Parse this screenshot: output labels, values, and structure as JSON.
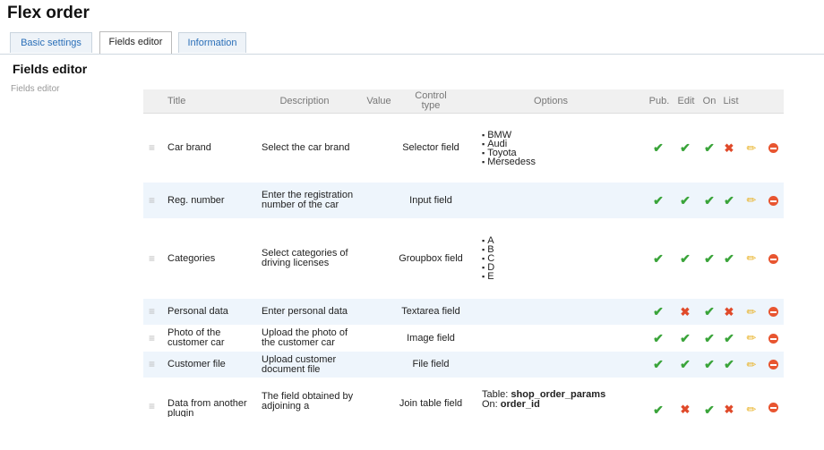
{
  "page": {
    "title": "Flex order"
  },
  "tabs": [
    {
      "label": "Basic settings"
    },
    {
      "label": "Fields editor"
    },
    {
      "label": "Information"
    }
  ],
  "section": {
    "title": "Fields editor",
    "side_label": "Fields editor"
  },
  "columns": {
    "title": "Title",
    "description": "Description",
    "value": "Value",
    "control_type": "Control type",
    "options": "Options",
    "pub": "Pub.",
    "edit": "Edit",
    "on": "On",
    "list": "List"
  },
  "icons": {
    "handle": "drag-handle-icon",
    "check": "check-icon",
    "cross": "cross-icon",
    "edit": "pencil-icon",
    "delete": "delete-icon"
  },
  "colors": {
    "tab_link": "#2a6fb8",
    "check": "#3aa43a",
    "cross": "#e04a2a",
    "pencil": "#e8b020",
    "delete": "#e85530",
    "row_alt": "#eef5fc"
  },
  "rows": [
    {
      "title": "Car brand",
      "description": "Select the car brand",
      "control_type": "Selector field",
      "options": [
        "BMW",
        "Audi",
        "Toyota",
        "Mersedess"
      ],
      "pub": true,
      "edit": true,
      "on": true,
      "list": false
    },
    {
      "title": "Reg. number",
      "description": "Enter the registration number of the car",
      "control_type": "Input field",
      "options": [],
      "pub": true,
      "edit": true,
      "on": true,
      "list": true
    },
    {
      "title": "Categories",
      "description": "Select categories of driving licenses",
      "control_type": "Groupbox field",
      "options": [
        "A",
        "B",
        "C",
        "D",
        "E"
      ],
      "pub": true,
      "edit": true,
      "on": true,
      "list": true
    },
    {
      "title": "Personal data",
      "description": "Enter personal data",
      "control_type": "Textarea field",
      "options": [],
      "pub": true,
      "edit": false,
      "on": true,
      "list": false
    },
    {
      "title": "Photo of the customer car",
      "description": "Upload the photo of the customer car",
      "control_type": "Image field",
      "options": [],
      "pub": true,
      "edit": true,
      "on": true,
      "list": true
    },
    {
      "title": "Customer file",
      "description": "Upload customer document file",
      "control_type": "File field",
      "options": [],
      "pub": true,
      "edit": true,
      "on": true,
      "list": true
    },
    {
      "title": "Data from another plugin",
      "description": "The field obtained by adjoining a",
      "control_type": "Join table field",
      "options_table": {
        "table_label": "Table:",
        "table_value": "shop_order_params",
        "on_label": "On:",
        "on_value": "order_id"
      },
      "pub": true,
      "edit": false,
      "on": true,
      "list": false
    }
  ]
}
